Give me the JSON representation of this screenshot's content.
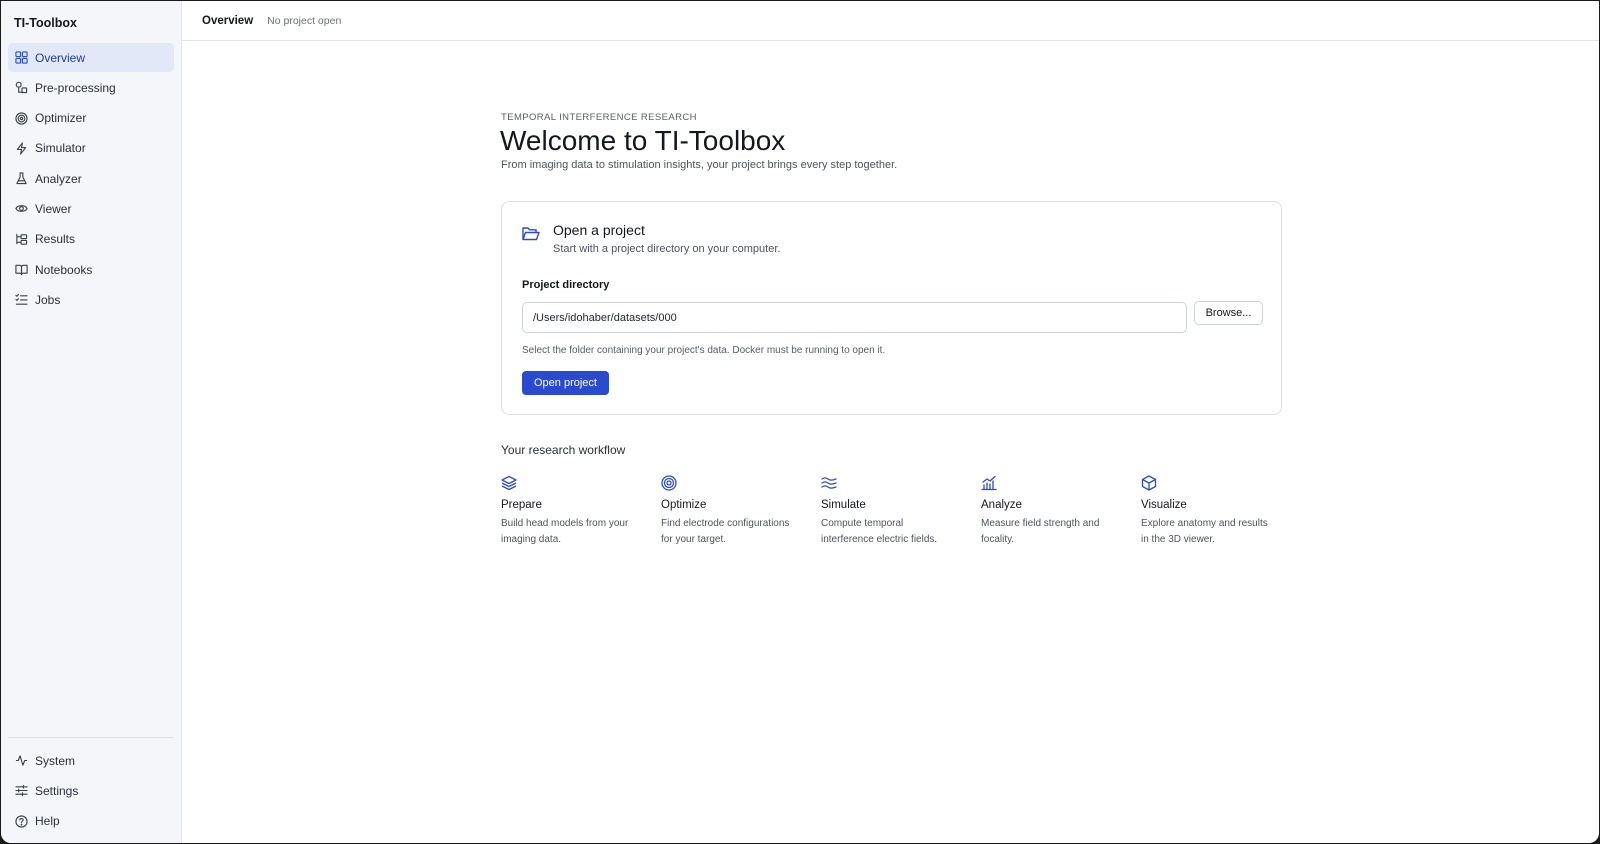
{
  "app": {
    "title": "TI-Toolbox"
  },
  "sidebar": {
    "items": [
      {
        "label": "Overview",
        "icon": "grid-icon",
        "active": true
      },
      {
        "label": "Pre-processing",
        "icon": "shapes-icon"
      },
      {
        "label": "Optimizer",
        "icon": "target-icon"
      },
      {
        "label": "Simulator",
        "icon": "bolt-icon"
      },
      {
        "label": "Analyzer",
        "icon": "flask-icon"
      },
      {
        "label": "Viewer",
        "icon": "eye-icon"
      },
      {
        "label": "Results",
        "icon": "tree-icon"
      },
      {
        "label": "Notebooks",
        "icon": "book-icon"
      },
      {
        "label": "Jobs",
        "icon": "checklist-icon"
      }
    ],
    "bottom_items": [
      {
        "label": "System",
        "icon": "pulse-icon"
      },
      {
        "label": "Settings",
        "icon": "sliders-icon"
      },
      {
        "label": "Help",
        "icon": "help-icon"
      }
    ]
  },
  "topbar": {
    "breadcrumb": "Overview",
    "status": "No project open"
  },
  "hero": {
    "eyebrow": "TEMPORAL INTERFERENCE RESEARCH",
    "title": "Welcome to TI-Toolbox",
    "subtitle": "From imaging data to stimulation insights, your project brings every step together."
  },
  "open_project": {
    "title": "Open a project",
    "subtitle": "Start with a project directory on your computer.",
    "field_label": "Project directory",
    "directory_value": "/Users/idohaber/datasets/000",
    "browse_label": "Browse...",
    "help_text": "Select the folder containing your project's data. Docker must be running to open it.",
    "open_label": "Open project"
  },
  "workflow": {
    "title": "Your research workflow",
    "steps": [
      {
        "title": "Prepare",
        "description": "Build head models from your imaging data.",
        "icon": "layers-icon"
      },
      {
        "title": "Optimize",
        "description": "Find electrode configurations for your target.",
        "icon": "target-icon"
      },
      {
        "title": "Simulate",
        "description": "Compute temporal interference electric fields.",
        "icon": "waves-icon"
      },
      {
        "title": "Analyze",
        "description": "Measure field strength and focality.",
        "icon": "chart-icon"
      },
      {
        "title": "Visualize",
        "description": "Explore anatomy and results in the 3D viewer.",
        "icon": "cube-icon"
      }
    ]
  },
  "colors": {
    "accent": "#2a4bd0",
    "active_nav_bg": "#e2e8f7",
    "sidebar_bg": "#f5f6fa"
  }
}
